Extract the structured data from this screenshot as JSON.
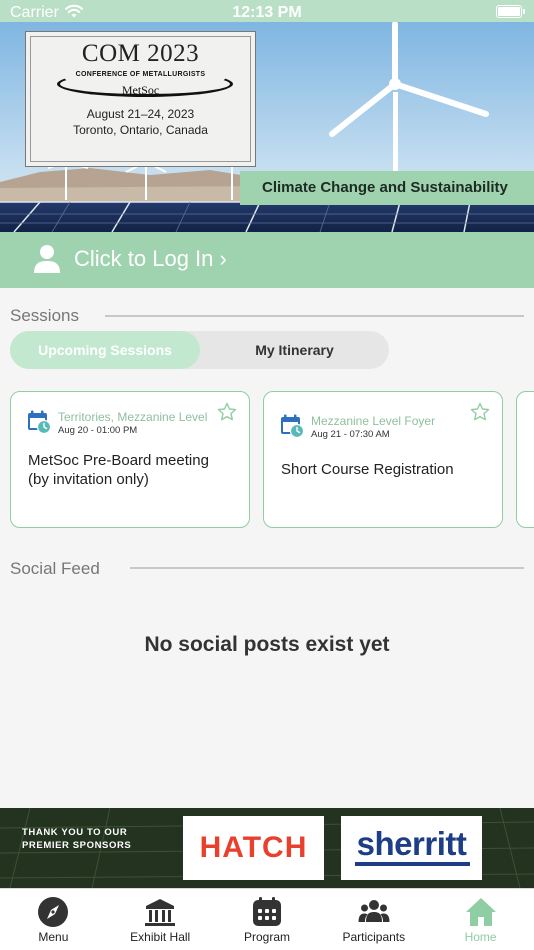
{
  "status_bar": {
    "carrier": "Carrier",
    "time": "12:13 PM"
  },
  "hero": {
    "conference": {
      "title": "COM 2023",
      "subtitle": "CONFERENCE OF METALLURGISTS",
      "org": "MetSoc",
      "dates": "August 21–24, 2023",
      "location": "Toronto, Ontario, Canada"
    },
    "theme": "Climate Change and Sustainability"
  },
  "login": {
    "label": "Click to Log In ›",
    "icon": "user-icon"
  },
  "sessions": {
    "heading": "Sessions",
    "tabs": [
      {
        "label": "Upcoming Sessions",
        "selected": true
      },
      {
        "label": "My Itinerary",
        "selected": false
      }
    ],
    "cards": [
      {
        "location": "Territories, Mezzanine Level",
        "when": "Aug 20 - 01:00 PM",
        "title_lines": [
          "MetSoc Pre-Board meeting",
          "(by invitation only)"
        ]
      },
      {
        "location": "Mezzanine Level Foyer",
        "when": "Aug 21 - 07:30 AM",
        "title_lines": [
          "Short Course Registration"
        ]
      }
    ]
  },
  "social": {
    "heading": "Social Feed",
    "empty_message": "No social posts exist yet"
  },
  "sponsors": {
    "thanks_text": "THANK YOU TO OUR PREMIER SPONSORS",
    "logos": [
      "HATCH",
      "sherritt"
    ]
  },
  "tabbar": {
    "tabs": [
      {
        "label": "Menu",
        "icon": "compass-icon"
      },
      {
        "label": "Exhibit Hall",
        "icon": "building-icon"
      },
      {
        "label": "Program",
        "icon": "calendar-icon"
      },
      {
        "label": "Participants",
        "icon": "people-icon"
      },
      {
        "label": "Home",
        "icon": "home-icon",
        "active": true
      }
    ]
  },
  "colors": {
    "accent": "#9fd3b0",
    "accent_light": "#c2e8cf",
    "card_border": "#8fcda2",
    "status_bar": "#b9dfc6"
  }
}
